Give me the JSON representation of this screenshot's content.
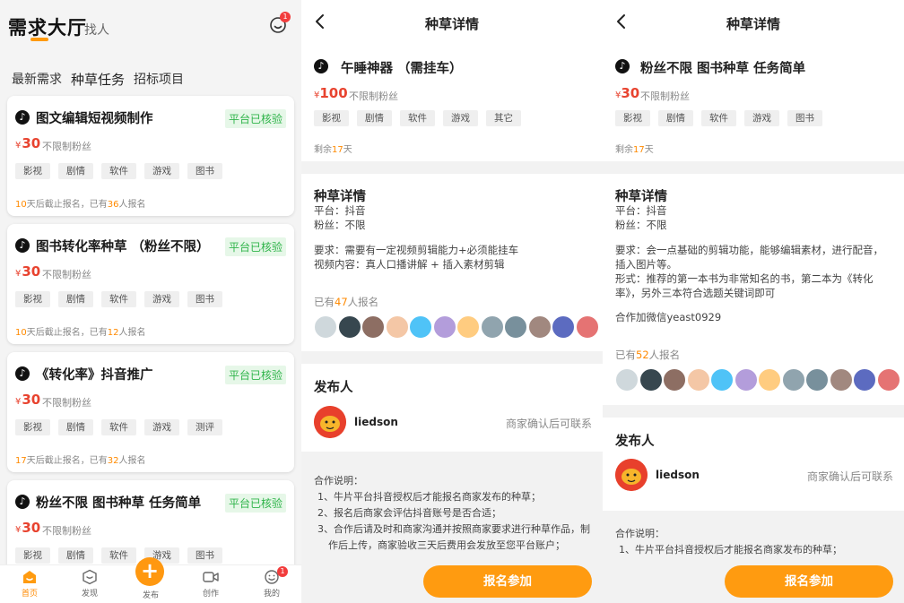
{
  "hall": {
    "title": "需求大厅",
    "people_tab": "找人",
    "msg_badge": "1",
    "subtabs": [
      "最新需求",
      "种草任务",
      "招标项目"
    ],
    "cards": [
      {
        "title": "图文编辑短视频制作",
        "verified": "平台已核验",
        "price_symbol": "¥",
        "price": "30",
        "fans": "不限制粉丝",
        "tags": [
          "影视",
          "剧情",
          "软件",
          "游戏",
          "图书"
        ],
        "days": "10",
        "days_suffix": "天后截止报名，已有",
        "count": "36",
        "count_suffix": "人报名"
      },
      {
        "title": "图书转化率种草 （粉丝不限）",
        "verified": "平台已核验",
        "price_symbol": "¥",
        "price": "30",
        "fans": "不限制粉丝",
        "tags": [
          "影视",
          "剧情",
          "软件",
          "游戏",
          "图书"
        ],
        "days": "10",
        "days_suffix": "天后截止报名，已有",
        "count": "12",
        "count_suffix": "人报名"
      },
      {
        "title": "《转化率》抖音推广",
        "verified": "平台已核验",
        "price_symbol": "¥",
        "price": "30",
        "fans": "不限制粉丝",
        "tags": [
          "影视",
          "剧情",
          "软件",
          "游戏",
          "测评"
        ],
        "days": "17",
        "days_suffix": "天后截止报名，已有",
        "count": "32",
        "count_suffix": "人报名"
      },
      {
        "title": "粉丝不限 图书种草 任务简单",
        "verified": "平台已核验",
        "price_symbol": "¥",
        "price": "30",
        "fans": "不限制粉丝",
        "tags": [
          "影视",
          "剧情",
          "软件",
          "游戏",
          "图书"
        ],
        "days": "",
        "days_suffix": "",
        "count": "",
        "count_suffix": ""
      }
    ],
    "nav": [
      {
        "label": "首页",
        "icon": "home-icon"
      },
      {
        "label": "发现",
        "icon": "discover-icon"
      },
      {
        "label": "发布",
        "icon": "plus-icon"
      },
      {
        "label": "创作",
        "icon": "video-icon"
      },
      {
        "label": "我的",
        "icon": "profile-icon"
      }
    ],
    "nav_badge": "1",
    "colors": {
      "accent": "#ff9b10",
      "price": "#e8432f",
      "verified": "#2fb44a"
    }
  },
  "detail1": {
    "header": "种草详情",
    "title": "午睡神器 （需挂车）",
    "price_symbol": "¥",
    "price": "100",
    "fans": "不限制粉丝",
    "tags": [
      "影视",
      "剧情",
      "软件",
      "游戏",
      "其它"
    ],
    "remain_prefix": "剩余",
    "remain_days": "17",
    "remain_suffix": "天",
    "section_title": "种草详情",
    "platform": "平台：抖音",
    "fans_line": "粉丝：不限",
    "requirements": [
      "要求：需要有一定视频剪辑能力+必须能挂车",
      "视频内容：真人口播讲解 + 插入素材剪辑"
    ],
    "signed_prefix": "已有",
    "signed_count": "47",
    "signed_suffix": "人报名",
    "publisher_title": "发布人",
    "publisher_name": "liedson",
    "publisher_note": "商家确认后可联系",
    "coop_title": "合作说明：",
    "coop_lines": [
      "1、牛片平台抖音授权后才能报名商家发布的种草；",
      "2、报名后商家会评估抖音账号是否合适；",
      "3、合作后请及时和商家沟通并按照商家要求进行种草作品，制",
      "作后上传，商家验收三天后费用会发放至您平台账户；"
    ],
    "join_label": "报名参加"
  },
  "detail2": {
    "header": "种草详情",
    "title": "粉丝不限 图书种草 任务简单",
    "price_symbol": "¥",
    "price": "30",
    "fans": "不限制粉丝",
    "tags": [
      "影视",
      "剧情",
      "软件",
      "游戏",
      "图书"
    ],
    "remain_prefix": "剩余",
    "remain_days": "17",
    "remain_suffix": "天",
    "section_title": "种草详情",
    "platform": "平台：抖音",
    "fans_line": "粉丝：不限",
    "requirements": [
      "要求：会一点基础的剪辑功能，能够编辑素材，进行配音，",
      "插入图片等。",
      "形式：推荐的第一本书为非常知名的书，第二本为《转化",
      "率》，另外三本符合选题关键词即可"
    ],
    "contact": "合作加微信yeast0929",
    "signed_prefix": "已有",
    "signed_count": "52",
    "signed_suffix": "人报名",
    "publisher_title": "发布人",
    "publisher_name": "liedson",
    "publisher_note": "商家确认后可联系",
    "coop_title": "合作说明：",
    "coop_lines": [
      "1、牛片平台抖音授权后才能报名商家发布的种草；"
    ],
    "join_label": "报名参加"
  }
}
